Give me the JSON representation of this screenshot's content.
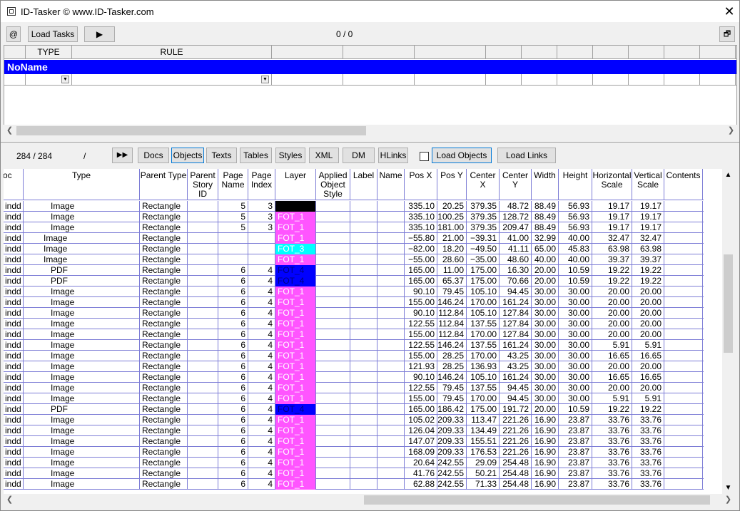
{
  "title": "ID-Tasker  © www.ID-Tasker.com",
  "toolbar": {
    "at_label": "@",
    "load_tasks": "Load Tasks",
    "play": "▶",
    "counter": "0 / 0",
    "restore": "🗗"
  },
  "task_grid": {
    "headers": [
      "TYPE",
      "RULE"
    ],
    "noname": "NoName"
  },
  "objects_bar": {
    "pager": "284 / 284",
    "slash": "/",
    "ff": "▶▶",
    "tabs": [
      "Docs",
      "Objects",
      "Texts",
      "Tables",
      "Styles",
      "XML",
      "DM",
      "HLinks"
    ],
    "load_objects": "Load Objects",
    "load_links": "Load Links"
  },
  "columns": [
    "oc",
    "Type",
    "Parent Type",
    "Parent Story ID",
    "Page Name",
    "Page Index",
    "Layer",
    "Applied Object Style",
    "Label",
    "Name",
    "Pos X",
    "Pos Y",
    "Center X",
    "Center Y",
    "Width",
    "Height",
    "Horizontal Scale",
    "Vertical Scale",
    "Contents"
  ],
  "layer_colors": {
    "black": "#000000",
    "magenta": "#ff55ff",
    "cyan": "#00ffff",
    "blue": "#0000ff"
  },
  "rows": [
    [
      "indd",
      "Image",
      "Rectangle",
      "",
      "5",
      "3",
      "",
      "black",
      "335.10",
      "20.25",
      "379.35",
      "48.72",
      "88.49",
      "56.93",
      "19.17",
      "19.17"
    ],
    [
      "indd",
      "Image",
      "Rectangle",
      "",
      "5",
      "3",
      "FOT_1",
      "magenta",
      "335.10",
      "100.25",
      "379.35",
      "128.72",
      "88.49",
      "56.93",
      "19.17",
      "19.17"
    ],
    [
      "indd",
      "Image",
      "Rectangle",
      "",
      "5",
      "3",
      "FOT_1",
      "magenta",
      "335.10",
      "181.00",
      "379.35",
      "209.47",
      "88.49",
      "56.93",
      "19.17",
      "19.17"
    ],
    [
      "indd",
      "Image",
      "Rectangle",
      "",
      "",
      "",
      "FOT_1",
      "magenta",
      "−55.80",
      "21.00",
      "−39.31",
      "41.00",
      "32.99",
      "40.00",
      "32.47",
      "32.47"
    ],
    [
      "indd",
      "Image",
      "Rectangle",
      "",
      "",
      "",
      "FOT_3",
      "cyan",
      "−82.00",
      "18.20",
      "−49.50",
      "41.11",
      "65.00",
      "45.83",
      "63.98",
      "63.98"
    ],
    [
      "indd",
      "Image",
      "Rectangle",
      "",
      "",
      "",
      "FOT_1",
      "magenta",
      "−55.00",
      "28.60",
      "−35.00",
      "48.60",
      "40.00",
      "40.00",
      "39.37",
      "39.37"
    ],
    [
      "indd",
      "PDF",
      "Rectangle",
      "",
      "6",
      "4",
      "FOT_4",
      "blue",
      "165.00",
      "11.00",
      "175.00",
      "16.30",
      "20.00",
      "10.59",
      "19.22",
      "19.22"
    ],
    [
      "indd",
      "PDF",
      "Rectangle",
      "",
      "6",
      "4",
      "FOT_4",
      "blue",
      "165.00",
      "65.37",
      "175.00",
      "70.66",
      "20.00",
      "10.59",
      "19.22",
      "19.22"
    ],
    [
      "indd",
      "Image",
      "Rectangle",
      "",
      "6",
      "4",
      "FOT_1",
      "magenta",
      "90.10",
      "79.45",
      "105.10",
      "94.45",
      "30.00",
      "30.00",
      "20.00",
      "20.00"
    ],
    [
      "indd",
      "Image",
      "Rectangle",
      "",
      "6",
      "4",
      "FOT_1",
      "magenta",
      "155.00",
      "146.24",
      "170.00",
      "161.24",
      "30.00",
      "30.00",
      "20.00",
      "20.00"
    ],
    [
      "indd",
      "Image",
      "Rectangle",
      "",
      "6",
      "4",
      "FOT_1",
      "magenta",
      "90.10",
      "112.84",
      "105.10",
      "127.84",
      "30.00",
      "30.00",
      "20.00",
      "20.00"
    ],
    [
      "indd",
      "Image",
      "Rectangle",
      "",
      "6",
      "4",
      "FOT_1",
      "magenta",
      "122.55",
      "112.84",
      "137.55",
      "127.84",
      "30.00",
      "30.00",
      "20.00",
      "20.00"
    ],
    [
      "indd",
      "Image",
      "Rectangle",
      "",
      "6",
      "4",
      "FOT_1",
      "magenta",
      "155.00",
      "112.84",
      "170.00",
      "127.84",
      "30.00",
      "30.00",
      "20.00",
      "20.00"
    ],
    [
      "indd",
      "Image",
      "Rectangle",
      "",
      "6",
      "4",
      "FOT_1",
      "magenta",
      "122.55",
      "146.24",
      "137.55",
      "161.24",
      "30.00",
      "30.00",
      "5.91",
      "5.91"
    ],
    [
      "indd",
      "Image",
      "Rectangle",
      "",
      "6",
      "4",
      "FOT_1",
      "magenta",
      "155.00",
      "28.25",
      "170.00",
      "43.25",
      "30.00",
      "30.00",
      "16.65",
      "16.65"
    ],
    [
      "indd",
      "Image",
      "Rectangle",
      "",
      "6",
      "4",
      "FOT_1",
      "magenta",
      "121.93",
      "28.25",
      "136.93",
      "43.25",
      "30.00",
      "30.00",
      "20.00",
      "20.00"
    ],
    [
      "indd",
      "Image",
      "Rectangle",
      "",
      "6",
      "4",
      "FOT_1",
      "magenta",
      "90.10",
      "146.24",
      "105.10",
      "161.24",
      "30.00",
      "30.00",
      "16.65",
      "16.65"
    ],
    [
      "indd",
      "Image",
      "Rectangle",
      "",
      "6",
      "4",
      "FOT_1",
      "magenta",
      "122.55",
      "79.45",
      "137.55",
      "94.45",
      "30.00",
      "30.00",
      "20.00",
      "20.00"
    ],
    [
      "indd",
      "Image",
      "Rectangle",
      "",
      "6",
      "4",
      "FOT_1",
      "magenta",
      "155.00",
      "79.45",
      "170.00",
      "94.45",
      "30.00",
      "30.00",
      "5.91",
      "5.91"
    ],
    [
      "indd",
      "PDF",
      "Rectangle",
      "",
      "6",
      "4",
      "FOT_4",
      "blue",
      "165.00",
      "186.42",
      "175.00",
      "191.72",
      "20.00",
      "10.59",
      "19.22",
      "19.22"
    ],
    [
      "indd",
      "Image",
      "Rectangle",
      "",
      "6",
      "4",
      "FOT_1",
      "magenta",
      "105.02",
      "209.33",
      "113.47",
      "221.26",
      "16.90",
      "23.87",
      "33.76",
      "33.76"
    ],
    [
      "indd",
      "Image",
      "Rectangle",
      "",
      "6",
      "4",
      "FOT_1",
      "magenta",
      "126.04",
      "209.33",
      "134.49",
      "221.26",
      "16.90",
      "23.87",
      "33.76",
      "33.76"
    ],
    [
      "indd",
      "Image",
      "Rectangle",
      "",
      "6",
      "4",
      "FOT_1",
      "magenta",
      "147.07",
      "209.33",
      "155.51",
      "221.26",
      "16.90",
      "23.87",
      "33.76",
      "33.76"
    ],
    [
      "indd",
      "Image",
      "Rectangle",
      "",
      "6",
      "4",
      "FOT_1",
      "magenta",
      "168.09",
      "209.33",
      "176.53",
      "221.26",
      "16.90",
      "23.87",
      "33.76",
      "33.76"
    ],
    [
      "indd",
      "Image",
      "Rectangle",
      "",
      "6",
      "4",
      "FOT_1",
      "magenta",
      "20.64",
      "242.55",
      "29.09",
      "254.48",
      "16.90",
      "23.87",
      "33.76",
      "33.76"
    ],
    [
      "indd",
      "Image",
      "Rectangle",
      "",
      "6",
      "4",
      "FOT_1",
      "magenta",
      "41.76",
      "242.55",
      "50.21",
      "254.48",
      "16.90",
      "23.87",
      "33.76",
      "33.76"
    ],
    [
      "indd",
      "Image",
      "Rectangle",
      "",
      "6",
      "4",
      "FOT_1",
      "magenta",
      "62.88",
      "242.55",
      "71.33",
      "254.48",
      "16.90",
      "23.87",
      "33.76",
      "33.76"
    ]
  ]
}
